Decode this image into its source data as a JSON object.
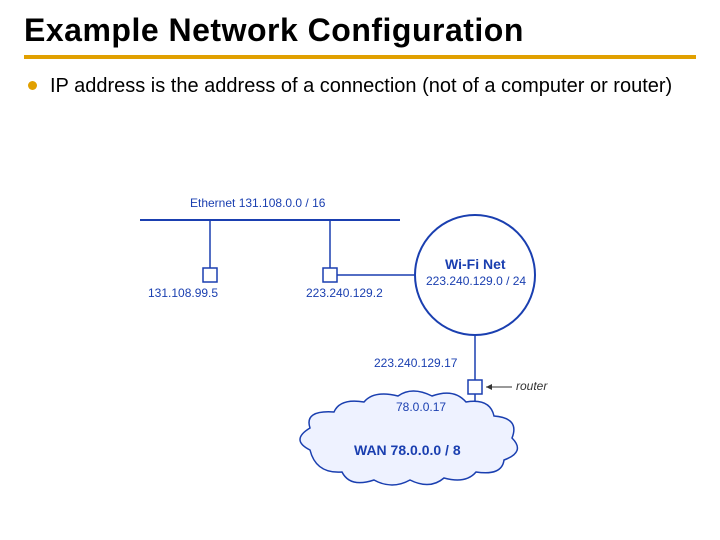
{
  "title": "Example  Network Configuration",
  "bullet": "IP address is the address of a connection (not of a computer or router)",
  "diagram": {
    "ethernet_label": "Ethernet  131.108.0.0 / 16",
    "host1_ip": "131.108.99.5",
    "host2_ip": "223.240.129.2",
    "wifi_name": "Wi-Fi Net",
    "wifi_net": "223.240.129.0 / 24",
    "router_if_wifi": "223.240.129.17",
    "router_if_wan": "78.0.0.17",
    "router_label": "router",
    "wan_label": "WAN  78.0.0.0 / 8"
  }
}
